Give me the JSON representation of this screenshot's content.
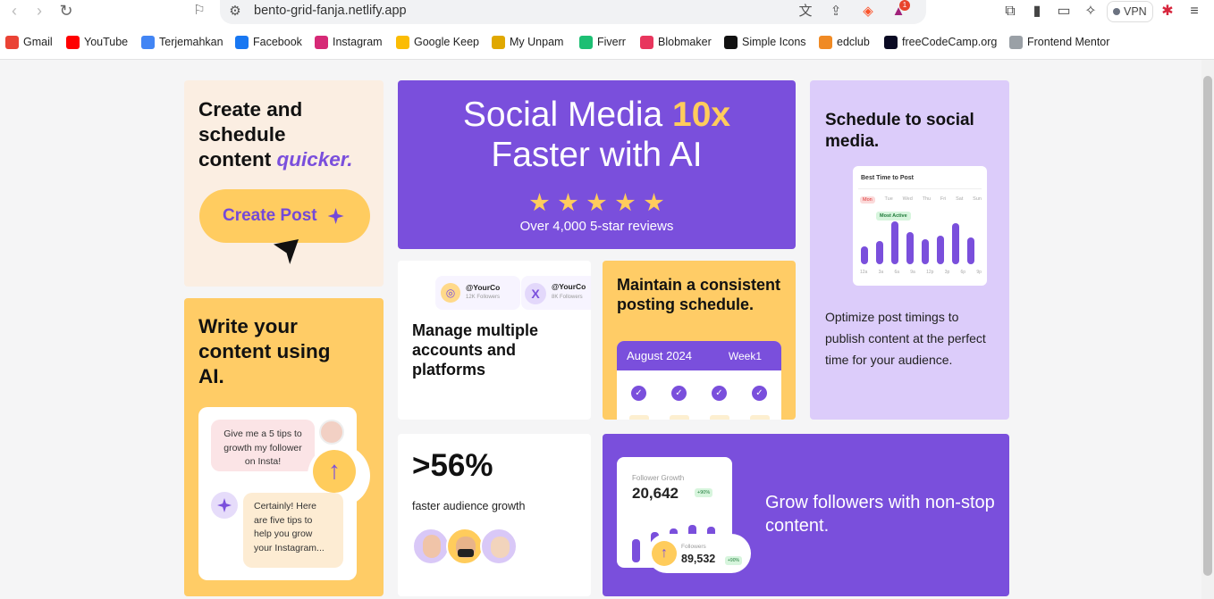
{
  "browser": {
    "url": "bento-grid-fanja.netlify.app",
    "vpn_label": "VPN",
    "notif_count": "1",
    "bookmarks": [
      {
        "label": "Gmail",
        "icon": "gmail-icon",
        "color": "#ea4335"
      },
      {
        "label": "YouTube",
        "icon": "youtube-icon",
        "color": "#ff0000"
      },
      {
        "label": "Terjemahkan",
        "icon": "translate-icon",
        "color": "#4285f4"
      },
      {
        "label": "Facebook",
        "icon": "facebook-icon",
        "color": "#1877f2"
      },
      {
        "label": "Instagram",
        "icon": "instagram-icon",
        "color": "#d62976"
      },
      {
        "label": "Google Keep",
        "icon": "keep-icon",
        "color": "#fbbc04"
      },
      {
        "label": "My Unpam",
        "icon": "unpam-icon",
        "color": "#e0a800"
      },
      {
        "label": "Fiverr",
        "icon": "fiverr-icon",
        "color": "#1dbf73"
      },
      {
        "label": "Blobmaker",
        "icon": "blobmaker-icon",
        "color": "#e8365d"
      },
      {
        "label": "Simple Icons",
        "icon": "simpleicons-icon",
        "color": "#111111"
      },
      {
        "label": "edclub",
        "icon": "edclub-icon",
        "color": "#f08a24"
      },
      {
        "label": "freeCodeCamp.org",
        "icon": "freecodecamp-icon",
        "color": "#0a0a23"
      },
      {
        "label": "Frontend Mentor",
        "icon": "frontendmentor-icon",
        "color": "#9aa0a6"
      }
    ]
  },
  "cards": {
    "create": {
      "line1": "Create and",
      "line2": "schedule",
      "line3": "content",
      "accent": "quicker.",
      "button": "Create Post"
    },
    "hero": {
      "title_a": "Social Media",
      "title_accent": "10x",
      "title_b": "Faster with AI",
      "reviews": "Over 4,000 5-star reviews",
      "stars": 5
    },
    "schedule": {
      "title": "Schedule to social media.",
      "widget_title": "Best Time to Post",
      "days": [
        "Mon",
        "Tue",
        "Wed",
        "Thu",
        "Fri",
        "Sat",
        "Sun"
      ],
      "badge": "Most Active",
      "times": [
        "12a",
        "3a",
        "6a",
        "9a",
        "12p",
        "3p",
        "6p",
        "9p"
      ],
      "description": "Optimize post timings to publish content at the perfect time for your audience."
    },
    "ai": {
      "title": "Write your content using AI.",
      "user_msg": "Give me a 5 tips to growth my follower on Insta!",
      "bot_msg": "Certainly! Here are five tips to help you grow your Instagram..."
    },
    "accounts": {
      "title": "Manage multiple accounts and platforms",
      "acct1_name": "@YourCo",
      "acct1_sub": "12K Followers",
      "acct2_name": "@YourCo",
      "acct2_sub": "8K Followers"
    },
    "consistent": {
      "title": "Maintain a consistent posting schedule.",
      "month": "August 2024",
      "week": "Week1"
    },
    "growth": {
      "value": ">56%",
      "caption": "faster audience growth"
    },
    "followers": {
      "heading": "Grow followers with non-stop content.",
      "widget_title": "Follower Growth",
      "count": "20,642",
      "delta": "+90%",
      "sub_label": "Followers",
      "sub_count": "89,532",
      "sub_delta": "+90%"
    }
  }
}
